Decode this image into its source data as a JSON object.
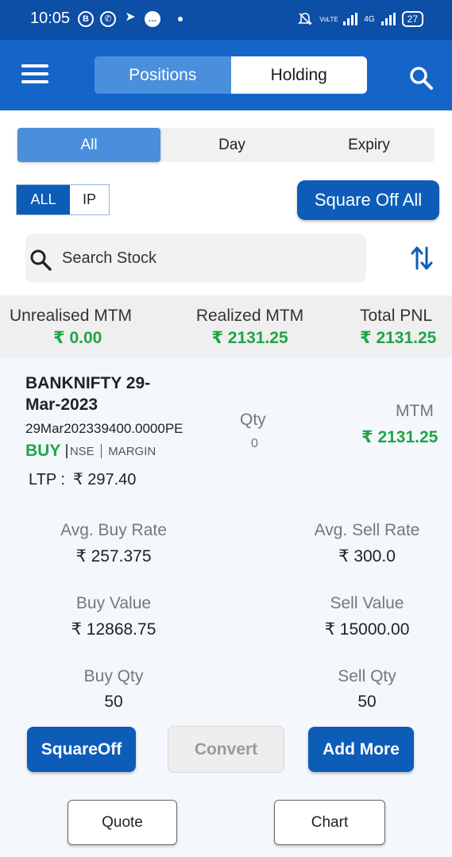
{
  "status_bar": {
    "time": "10:05",
    "notification_icons": [
      "b-icon",
      "whatsapp-icon",
      "telegram-icon",
      "messages-icon"
    ],
    "volte": "VoLTE",
    "network": "4G",
    "battery": "27"
  },
  "header": {
    "tabs": [
      {
        "label": "Positions",
        "active": true
      },
      {
        "label": "Holding",
        "active": false
      }
    ],
    "menu_icon": "hamburger-menu-icon",
    "search_icon": "search-icon"
  },
  "filters": {
    "tabs": [
      {
        "label": "All",
        "active": true
      },
      {
        "label": "Day",
        "active": false
      },
      {
        "label": "Expiry",
        "active": false
      }
    ]
  },
  "type_toggle": {
    "options": [
      {
        "label": "ALL",
        "active": true
      },
      {
        "label": "IP",
        "active": false
      }
    ]
  },
  "square_off_all_label": "Square Off All",
  "search": {
    "placeholder": "Search Stock",
    "value": ""
  },
  "summary": {
    "unrealised_label": "Unrealised MTM",
    "unrealised_value": "₹ 0.00",
    "realized_label": "Realized MTM",
    "realized_value": "₹ 2131.25",
    "total_label": "Total PNL",
    "total_value": "₹ 2131.25"
  },
  "position": {
    "name": "BANKNIFTY 29-Mar-2023",
    "symbol": "29Mar202339400.0000PE",
    "side": "BUY",
    "exchange": "NSE",
    "product": "MARGIN",
    "ltp_label": "LTP :",
    "ltp_value": "₹ 297.40",
    "qty_label": "Qty",
    "qty_value": "0",
    "mtm_label": "MTM",
    "mtm_value": "₹ 2131.25",
    "avg_buy_label": "Avg. Buy Rate",
    "avg_buy_value": "₹ 257.375",
    "avg_sell_label": "Avg. Sell Rate",
    "avg_sell_value": "₹ 300.0",
    "buy_value_label": "Buy Value",
    "buy_value": "₹ 12868.75",
    "sell_value_label": "Sell Value",
    "sell_value": "₹ 15000.00",
    "buy_qty_label": "Buy Qty",
    "buy_qty": "50",
    "sell_qty_label": "Sell Qty",
    "sell_qty": "50"
  },
  "actions": {
    "square_off": "SquareOff",
    "convert": "Convert",
    "add_more": "Add More",
    "quote": "Quote",
    "chart": "Chart"
  },
  "colors": {
    "header_blue": "#1565c8",
    "status_blue": "#0d4ea6",
    "primary_button": "#0d5cb8",
    "active_tab": "#4a8fdb",
    "profit_green": "#22a447"
  }
}
